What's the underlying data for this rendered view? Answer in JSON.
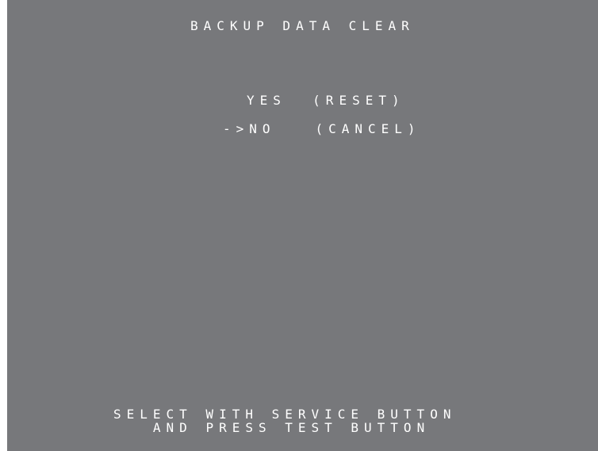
{
  "screen": {
    "title": "BACKUP DATA CLEAR",
    "options": [
      {
        "cursor": "",
        "label": "YES",
        "action": "(RESET)"
      },
      {
        "cursor": "->",
        "label": "NO",
        "action": "(CANCEL)"
      }
    ],
    "footer": {
      "line1": "SELECT WITH SERVICE BUTTON",
      "line2": "AND PRESS TEST BUTTON"
    },
    "colors": {
      "background": "#77787b",
      "text": "#ffffff"
    }
  }
}
